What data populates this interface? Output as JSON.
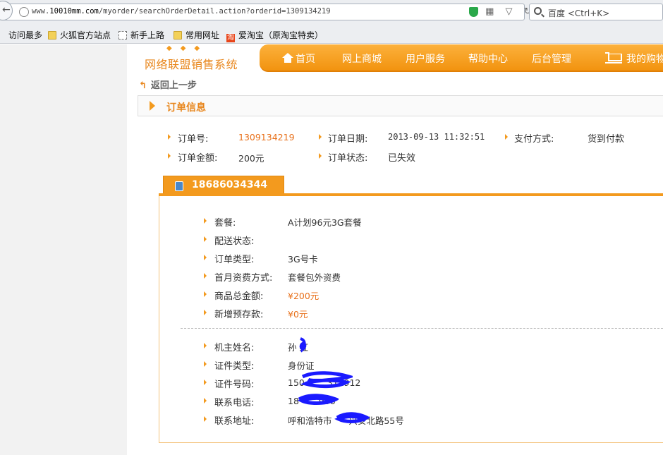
{
  "browser": {
    "url_prefix": "www.",
    "url_domain": "10010mm.com",
    "url_path": "/myorder/searchOrderDetail.action?orderid=1309134219",
    "search_placeholder": "百度 <Ctrl+K>",
    "url_icon_glyphs": "▦ ▽ ↻"
  },
  "bookmarks": [
    {
      "label": "访问最多",
      "icon": "gear-icon"
    },
    {
      "label": "火狐官方站点",
      "icon": "folder-icon"
    },
    {
      "label": "新手上路",
      "icon": "page-icon"
    },
    {
      "label": "常用网址",
      "icon": "folder-icon"
    },
    {
      "label": "爱淘宝（原淘宝特卖）",
      "icon": "taobao-icon",
      "icon_text": "淘"
    }
  ],
  "site": {
    "name": "网络联盟销售系统",
    "logo_wedges": "◆◆◆",
    "nav": [
      "首页",
      "网上商城",
      "用户服务",
      "帮助中心",
      "后台管理",
      "我的购物"
    ]
  },
  "back_link": {
    "icon_glyph": "↰",
    "label": "返回上一步"
  },
  "section_title": "订单信息",
  "order": {
    "order_no_label": "订单号:",
    "order_no": "1309134219",
    "order_date_label": "订单日期:",
    "order_date": "2013-09-13 11:32:51",
    "payment_label": "支付方式:",
    "payment": "货到付款",
    "amount_label": "订单金额:",
    "amount": "200元",
    "status_label": "订单状态:",
    "status": "已失效"
  },
  "phone_tab": "18686034344",
  "details": [
    {
      "label": "套餐:",
      "value": "A计划96元3G套餐"
    },
    {
      "label": "配送状态:",
      "value": ""
    },
    {
      "label": "订单类型:",
      "value": "3G号卡"
    },
    {
      "label": "首月资费方式:",
      "value": "套餐包外资费"
    },
    {
      "label": "商品总金额:",
      "value": "¥200元"
    },
    {
      "label": "新增预存款:",
      "value": "¥0元"
    }
  ],
  "owner": [
    {
      "label": "机主姓名:",
      "value": "孙 红"
    },
    {
      "label": "证件类型:",
      "value": "身份证"
    },
    {
      "label": "证件号码:",
      "value": "150        312912"
    },
    {
      "label": "联系电话:",
      "value": "18       966"
    },
    {
      "label": "联系地址:",
      "value": "呼和浩特市      兴安北路55号"
    }
  ],
  "colors": {
    "accent": "#f39a1e",
    "value_orange": "#e8701a",
    "redaction": "#1a1aff"
  }
}
